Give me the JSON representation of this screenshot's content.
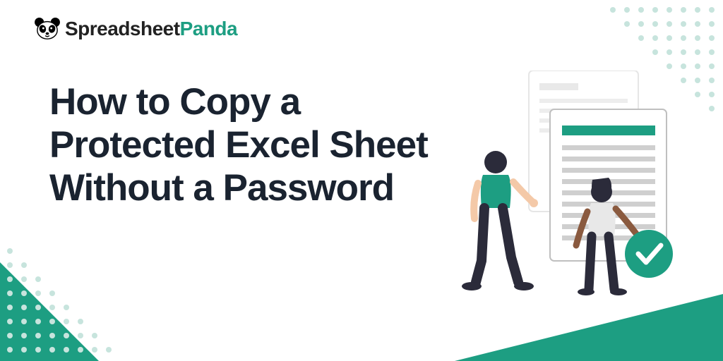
{
  "brand": {
    "name_part1": "Spreadsheet",
    "name_part2": "Panda"
  },
  "headline": "How to Copy a Protected Excel Sheet Without a Password",
  "colors": {
    "accent": "#1d9e82",
    "text": "#1a2330",
    "dot": "#c7e4dd"
  },
  "illustration": {
    "description": "two-people-with-document-checkmark"
  }
}
